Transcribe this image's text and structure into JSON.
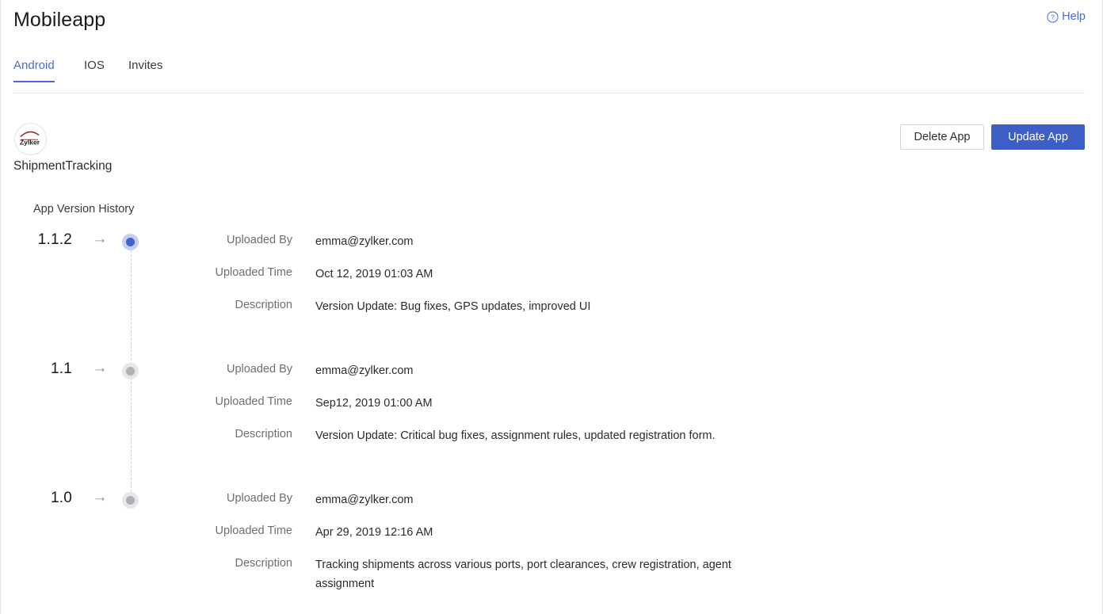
{
  "header": {
    "title": "Mobileapp",
    "help_label": "Help",
    "help_icon": "question-circle-icon",
    "accent_color": "#4a6bd6"
  },
  "tabs": [
    {
      "label": "Android",
      "active": true
    },
    {
      "label": "IOS",
      "active": false
    },
    {
      "label": "Invites",
      "active": false
    }
  ],
  "app": {
    "logo_text": "Zylker",
    "name": "ShipmentTracking"
  },
  "actions": {
    "delete_label": "Delete App",
    "update_label": "Update App",
    "update_color": "#3c5ec6"
  },
  "history": {
    "title": "App Version History",
    "labels": {
      "uploaded_by": "Uploaded By",
      "uploaded_time": "Uploaded Time",
      "description": "Description"
    },
    "arrow_icon": "arrow-right-icon",
    "versions": [
      {
        "version": "1.1.2",
        "state": "active",
        "uploaded_by": "emma@zylker.com",
        "uploaded_time": "Oct 12, 2019 01:03 AM",
        "description": "Version Update: Bug fixes, GPS updates, improved UI"
      },
      {
        "version": "1.1",
        "state": "inactive",
        "uploaded_by": "emma@zylker.com",
        "uploaded_time": "Sep12, 2019 01:00 AM",
        "description": "Version Update: Critical bug fixes, assignment rules, updated registration form."
      },
      {
        "version": "1.0",
        "state": "inactive",
        "uploaded_by": "emma@zylker.com",
        "uploaded_time": "Apr 29, 2019 12:16 AM",
        "description": "Tracking shipments across various ports, port clearances, crew registration, agent assignment"
      }
    ]
  }
}
